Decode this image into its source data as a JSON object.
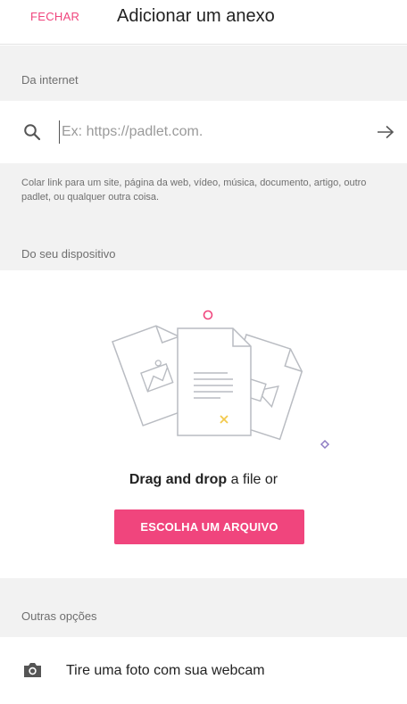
{
  "header": {
    "close_label": "FECHAR",
    "title": "Adicionar um anexo"
  },
  "internet": {
    "section_label": "Da internet",
    "url_placeholder": "Ex: https://padlet.com.",
    "url_value": "",
    "help_text": "Colar link para um site, página da web, vídeo, música, documento, artigo, outro padlet, ou qualquer outra coisa."
  },
  "device": {
    "section_label": "Do seu dispositivo",
    "drop_text_bold": "Drag and drop",
    "drop_text_rest": " a file or",
    "choose_button_label": "ESCOLHA UM ARQUIVO"
  },
  "other": {
    "section_label": "Outras opções",
    "webcam_label": "Tire uma foto com sua webcam"
  },
  "icons": {
    "search": "search-icon",
    "submit": "arrow-right-icon",
    "camera": "camera-icon"
  },
  "colors": {
    "accent": "#f0457d",
    "section_bg": "#f2f2f2",
    "muted_text": "#6f6f6f",
    "illustration_stroke": "#b9bcc2",
    "illustration_yellow": "#f2c94c",
    "illustration_purple": "#8e7cc3"
  }
}
